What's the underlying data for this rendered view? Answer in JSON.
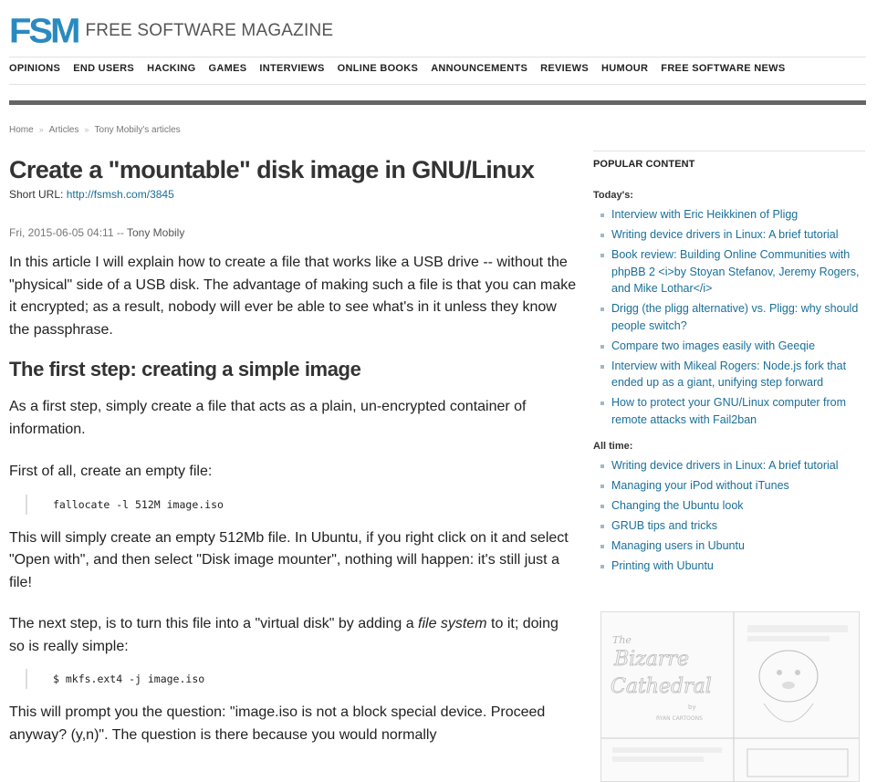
{
  "header": {
    "logo_mark": "FSM",
    "logo_text": "FREE SOFTWARE MAGAZINE",
    "nav": [
      "OPINIONS",
      "END USERS",
      "HACKING",
      "GAMES",
      "INTERVIEWS",
      "ONLINE BOOKS",
      "ANNOUNCEMENTS",
      "REVIEWS",
      "HUMOUR",
      "FREE SOFTWARE NEWS"
    ]
  },
  "breadcrumb": [
    "Home",
    "Articles",
    "Tony Mobily's articles"
  ],
  "article": {
    "title": "Create a \"mountable\" disk image in GNU/Linux",
    "short_url_label": "Short URL:",
    "short_url": "http://fsmsh.com/3845",
    "date": "Fri, 2015-06-05 04:11",
    "separator": "--",
    "author": "Tony Mobily",
    "intro": "In this article I will explain how to create a file that works like a USB drive -- without the \"physical\" side of a USB disk. The advantage of making such a file is that you can make it encrypted; as a result, nobody will ever be able to see what's in it unless they know the passphrase.",
    "h2": "The first step: creating a simple image",
    "p2": "As a first step, simply create a file that acts as a plain, un-encrypted container of information.",
    "p3": "First of all, create an empty file:",
    "code1": "fallocate -l 512M image.iso",
    "p4": "This will simply create an empty 512Mb file. In Ubuntu, if you right click on it and select \"Open with\", and then select \"Disk image mounter\", nothing will happen: it's still just a file!",
    "p5_a": "The next step, is to turn this file into a \"virtual disk\" by adding a ",
    "p5_em": "file system",
    "p5_b": " to it; doing so is really simple:",
    "code2": "$ mkfs.ext4 -j image.iso",
    "p6": "This will prompt you the question: \"image.iso is not a block special device. Proceed anyway? (y,n)\". The question is there because you would normally"
  },
  "sidebar": {
    "title": "POPULAR CONTENT",
    "today_label": "Today's:",
    "today": [
      "Interview with Eric Heikkinen of Pligg",
      "Writing device drivers in Linux: A brief tutorial",
      "Book review: Building Online Communities with phpBB 2 <i>by Stoyan Stefanov, Jeremy Rogers, and Mike Lothar</i>",
      "Drigg (the pligg alternative) vs. Pligg: why should people switch?",
      "Compare two images easily with Geeqie",
      "Interview with Mikeal Rogers: Node.js fork that ended up as a giant, unifying step forward",
      "How to protect your GNU/Linux computer from remote attacks with Fail2ban"
    ],
    "alltime_label": "All time:",
    "alltime": [
      "Writing device drivers in Linux: A brief tutorial",
      "Managing your iPod without iTunes",
      "Changing the Ubuntu look",
      "GRUB tips and tricks",
      "Managing users in Ubuntu",
      "Printing with Ubuntu"
    ]
  },
  "comic": {
    "title_line1": "The",
    "title_line2": "Bizarre",
    "title_line3": "Cathedral",
    "byline": "by",
    "author": "RYAN CARTOONS"
  },
  "colors": {
    "brand": "#2a8ac0",
    "link": "#1a6f99",
    "bar": "#666666"
  }
}
